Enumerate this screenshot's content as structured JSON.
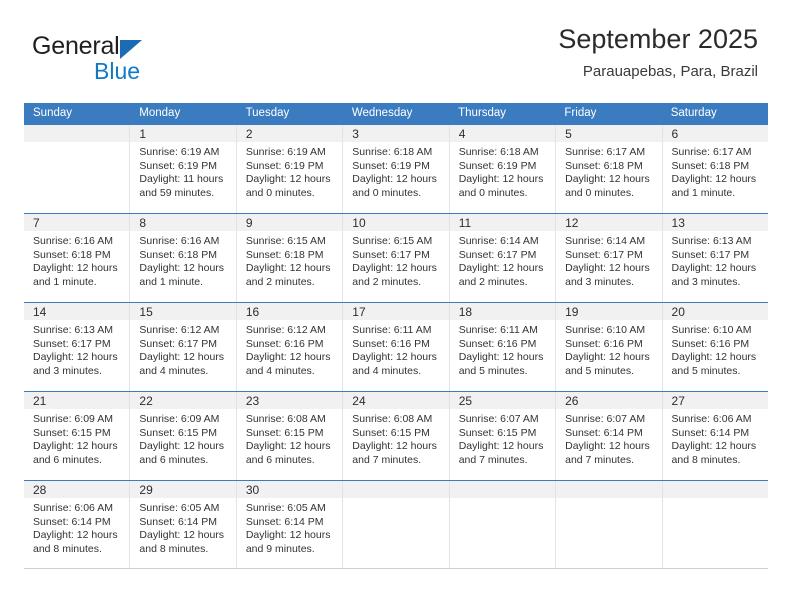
{
  "brand": {
    "word_one": "General",
    "word_two": "Blue",
    "accent_color": "#1279c7",
    "triangle_color": "#1c6cb5",
    "triangle_icon": "triangle-icon"
  },
  "header": {
    "title": "September 2025",
    "subtitle": "Parauapebas, Para, Brazil"
  },
  "calendar": {
    "header_bg": "#3b7cc0",
    "weekdays": [
      "Sunday",
      "Monday",
      "Tuesday",
      "Wednesday",
      "Thursday",
      "Friday",
      "Saturday"
    ],
    "weeks": [
      [
        {
          "day": "",
          "sunrise": "",
          "sunset": "",
          "daylight_line1": "",
          "daylight_line2": ""
        },
        {
          "day": "1",
          "sunrise": "Sunrise: 6:19 AM",
          "sunset": "Sunset: 6:19 PM",
          "daylight_line1": "Daylight: 11 hours",
          "daylight_line2": "and 59 minutes."
        },
        {
          "day": "2",
          "sunrise": "Sunrise: 6:19 AM",
          "sunset": "Sunset: 6:19 PM",
          "daylight_line1": "Daylight: 12 hours",
          "daylight_line2": "and 0 minutes."
        },
        {
          "day": "3",
          "sunrise": "Sunrise: 6:18 AM",
          "sunset": "Sunset: 6:19 PM",
          "daylight_line1": "Daylight: 12 hours",
          "daylight_line2": "and 0 minutes."
        },
        {
          "day": "4",
          "sunrise": "Sunrise: 6:18 AM",
          "sunset": "Sunset: 6:19 PM",
          "daylight_line1": "Daylight: 12 hours",
          "daylight_line2": "and 0 minutes."
        },
        {
          "day": "5",
          "sunrise": "Sunrise: 6:17 AM",
          "sunset": "Sunset: 6:18 PM",
          "daylight_line1": "Daylight: 12 hours",
          "daylight_line2": "and 0 minutes."
        },
        {
          "day": "6",
          "sunrise": "Sunrise: 6:17 AM",
          "sunset": "Sunset: 6:18 PM",
          "daylight_line1": "Daylight: 12 hours",
          "daylight_line2": "and 1 minute."
        }
      ],
      [
        {
          "day": "7",
          "sunrise": "Sunrise: 6:16 AM",
          "sunset": "Sunset: 6:18 PM",
          "daylight_line1": "Daylight: 12 hours",
          "daylight_line2": "and 1 minute."
        },
        {
          "day": "8",
          "sunrise": "Sunrise: 6:16 AM",
          "sunset": "Sunset: 6:18 PM",
          "daylight_line1": "Daylight: 12 hours",
          "daylight_line2": "and 1 minute."
        },
        {
          "day": "9",
          "sunrise": "Sunrise: 6:15 AM",
          "sunset": "Sunset: 6:18 PM",
          "daylight_line1": "Daylight: 12 hours",
          "daylight_line2": "and 2 minutes."
        },
        {
          "day": "10",
          "sunrise": "Sunrise: 6:15 AM",
          "sunset": "Sunset: 6:17 PM",
          "daylight_line1": "Daylight: 12 hours",
          "daylight_line2": "and 2 minutes."
        },
        {
          "day": "11",
          "sunrise": "Sunrise: 6:14 AM",
          "sunset": "Sunset: 6:17 PM",
          "daylight_line1": "Daylight: 12 hours",
          "daylight_line2": "and 2 minutes."
        },
        {
          "day": "12",
          "sunrise": "Sunrise: 6:14 AM",
          "sunset": "Sunset: 6:17 PM",
          "daylight_line1": "Daylight: 12 hours",
          "daylight_line2": "and 3 minutes."
        },
        {
          "day": "13",
          "sunrise": "Sunrise: 6:13 AM",
          "sunset": "Sunset: 6:17 PM",
          "daylight_line1": "Daylight: 12 hours",
          "daylight_line2": "and 3 minutes."
        }
      ],
      [
        {
          "day": "14",
          "sunrise": "Sunrise: 6:13 AM",
          "sunset": "Sunset: 6:17 PM",
          "daylight_line1": "Daylight: 12 hours",
          "daylight_line2": "and 3 minutes."
        },
        {
          "day": "15",
          "sunrise": "Sunrise: 6:12 AM",
          "sunset": "Sunset: 6:17 PM",
          "daylight_line1": "Daylight: 12 hours",
          "daylight_line2": "and 4 minutes."
        },
        {
          "day": "16",
          "sunrise": "Sunrise: 6:12 AM",
          "sunset": "Sunset: 6:16 PM",
          "daylight_line1": "Daylight: 12 hours",
          "daylight_line2": "and 4 minutes."
        },
        {
          "day": "17",
          "sunrise": "Sunrise: 6:11 AM",
          "sunset": "Sunset: 6:16 PM",
          "daylight_line1": "Daylight: 12 hours",
          "daylight_line2": "and 4 minutes."
        },
        {
          "day": "18",
          "sunrise": "Sunrise: 6:11 AM",
          "sunset": "Sunset: 6:16 PM",
          "daylight_line1": "Daylight: 12 hours",
          "daylight_line2": "and 5 minutes."
        },
        {
          "day": "19",
          "sunrise": "Sunrise: 6:10 AM",
          "sunset": "Sunset: 6:16 PM",
          "daylight_line1": "Daylight: 12 hours",
          "daylight_line2": "and 5 minutes."
        },
        {
          "day": "20",
          "sunrise": "Sunrise: 6:10 AM",
          "sunset": "Sunset: 6:16 PM",
          "daylight_line1": "Daylight: 12 hours",
          "daylight_line2": "and 5 minutes."
        }
      ],
      [
        {
          "day": "21",
          "sunrise": "Sunrise: 6:09 AM",
          "sunset": "Sunset: 6:15 PM",
          "daylight_line1": "Daylight: 12 hours",
          "daylight_line2": "and 6 minutes."
        },
        {
          "day": "22",
          "sunrise": "Sunrise: 6:09 AM",
          "sunset": "Sunset: 6:15 PM",
          "daylight_line1": "Daylight: 12 hours",
          "daylight_line2": "and 6 minutes."
        },
        {
          "day": "23",
          "sunrise": "Sunrise: 6:08 AM",
          "sunset": "Sunset: 6:15 PM",
          "daylight_line1": "Daylight: 12 hours",
          "daylight_line2": "and 6 minutes."
        },
        {
          "day": "24",
          "sunrise": "Sunrise: 6:08 AM",
          "sunset": "Sunset: 6:15 PM",
          "daylight_line1": "Daylight: 12 hours",
          "daylight_line2": "and 7 minutes."
        },
        {
          "day": "25",
          "sunrise": "Sunrise: 6:07 AM",
          "sunset": "Sunset: 6:15 PM",
          "daylight_line1": "Daylight: 12 hours",
          "daylight_line2": "and 7 minutes."
        },
        {
          "day": "26",
          "sunrise": "Sunrise: 6:07 AM",
          "sunset": "Sunset: 6:14 PM",
          "daylight_line1": "Daylight: 12 hours",
          "daylight_line2": "and 7 minutes."
        },
        {
          "day": "27",
          "sunrise": "Sunrise: 6:06 AM",
          "sunset": "Sunset: 6:14 PM",
          "daylight_line1": "Daylight: 12 hours",
          "daylight_line2": "and 8 minutes."
        }
      ],
      [
        {
          "day": "28",
          "sunrise": "Sunrise: 6:06 AM",
          "sunset": "Sunset: 6:14 PM",
          "daylight_line1": "Daylight: 12 hours",
          "daylight_line2": "and 8 minutes."
        },
        {
          "day": "29",
          "sunrise": "Sunrise: 6:05 AM",
          "sunset": "Sunset: 6:14 PM",
          "daylight_line1": "Daylight: 12 hours",
          "daylight_line2": "and 8 minutes."
        },
        {
          "day": "30",
          "sunrise": "Sunrise: 6:05 AM",
          "sunset": "Sunset: 6:14 PM",
          "daylight_line1": "Daylight: 12 hours",
          "daylight_line2": "and 9 minutes."
        },
        {
          "day": "",
          "sunrise": "",
          "sunset": "",
          "daylight_line1": "",
          "daylight_line2": ""
        },
        {
          "day": "",
          "sunrise": "",
          "sunset": "",
          "daylight_line1": "",
          "daylight_line2": ""
        },
        {
          "day": "",
          "sunrise": "",
          "sunset": "",
          "daylight_line1": "",
          "daylight_line2": ""
        },
        {
          "day": "",
          "sunrise": "",
          "sunset": "",
          "daylight_line1": "",
          "daylight_line2": ""
        }
      ]
    ]
  }
}
